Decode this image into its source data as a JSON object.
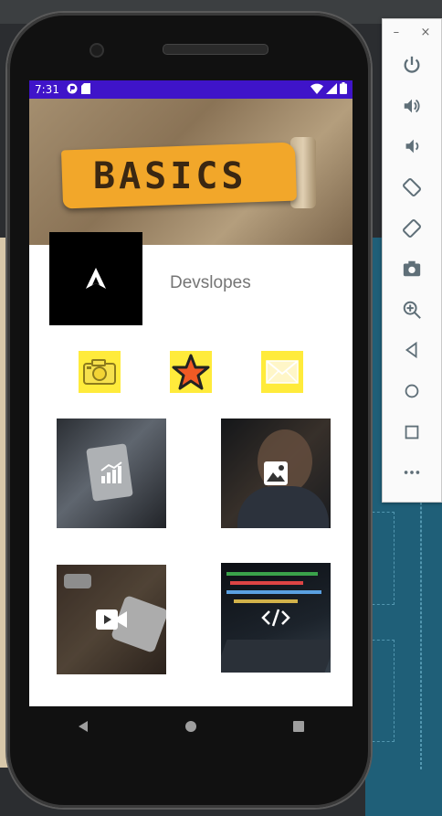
{
  "status_bar": {
    "time": "7:31",
    "left_icons": [
      "game-icon",
      "sd-card-icon"
    ],
    "right_icons": [
      "wifi-icon",
      "signal-icon",
      "battery-icon"
    ],
    "color": "#3f14c9"
  },
  "header": {
    "banner_text": "BASICS"
  },
  "profile": {
    "logo_icon": "arrow-logo-icon",
    "name": "Devslopes"
  },
  "action_buttons": [
    {
      "icon": "camera-icon"
    },
    {
      "icon": "star-icon"
    },
    {
      "icon": "mail-icon"
    }
  ],
  "tiles": [
    {
      "icon": "chart-icon",
      "subject": "analytics tablet"
    },
    {
      "icon": "image-icon",
      "subject": "thinking man"
    },
    {
      "icon": "video-icon",
      "subject": "drone parts"
    },
    {
      "icon": "code-icon",
      "subject": "code laptop"
    }
  ],
  "navbar": {
    "buttons": [
      "back-icon",
      "home-icon",
      "recents-icon"
    ]
  },
  "emulator_controls": {
    "window_buttons": [
      "–",
      "×"
    ],
    "buttons": [
      "power-icon",
      "volume-up-icon",
      "volume-down-icon",
      "rotate-left-icon",
      "rotate-right-icon",
      "screenshot-icon",
      "zoom-icon",
      "back-icon",
      "home-icon",
      "overview-icon",
      "more-icon"
    ]
  },
  "colors": {
    "accent_yellow": "#ffeb3b",
    "star_orange": "#f15a24",
    "name_gray": "#757575"
  }
}
